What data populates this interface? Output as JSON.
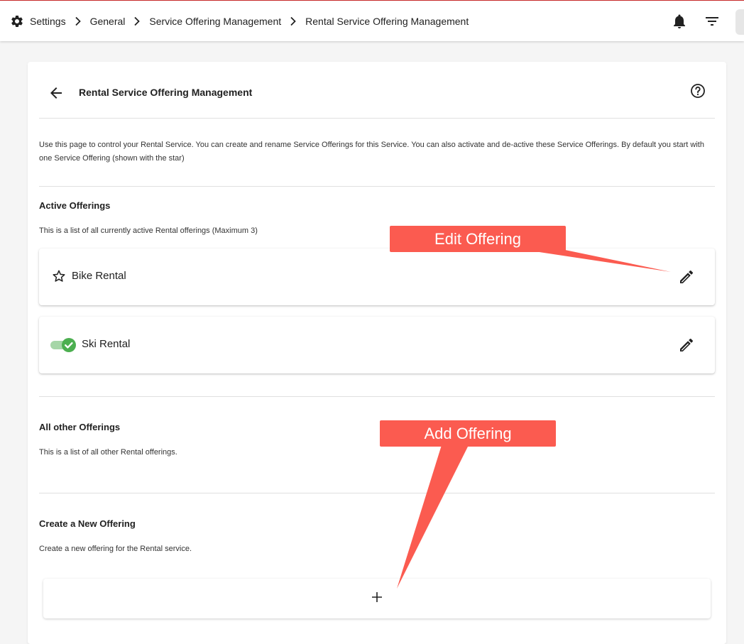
{
  "breadcrumb": {
    "items": [
      "Settings",
      "General",
      "Service Offering Management",
      "Rental Service Offering Management"
    ]
  },
  "page": {
    "title": "Rental Service Offering Management",
    "intro": "Use this page to control your Rental Service. You can create and rename Service Offerings for this Service. You can also activate and de-active these Service Offerings. By default you start with one Service Offering (shown with the star)"
  },
  "active": {
    "title": "Active Offerings",
    "description": "This is a list of all currently active Rental offerings (Maximum 3)",
    "offerings": [
      {
        "name": "Bike Rental",
        "indicator": "star-icon"
      },
      {
        "name": "Ski Rental",
        "indicator": "toggle-on"
      }
    ]
  },
  "other": {
    "title": "All other Offerings",
    "description": "This is a list of all other Rental offerings."
  },
  "create": {
    "title": "Create a New Offering",
    "description": "Create a new offering for the Rental service."
  },
  "callouts": {
    "edit": "Edit Offering",
    "add": "Add Offering"
  },
  "colors": {
    "callout": "#fb5b50",
    "toggle_track": "#a5d6a7",
    "toggle_knob": "#4caf50",
    "topbar_accent": "#c62828"
  }
}
